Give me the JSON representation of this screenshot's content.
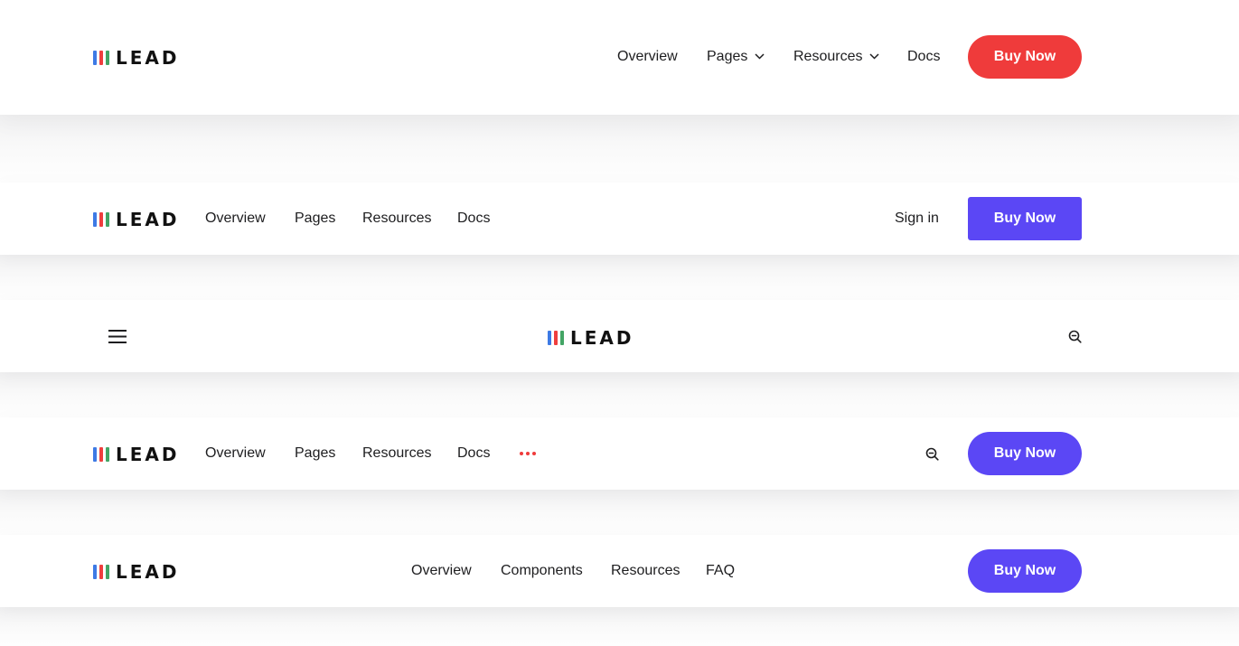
{
  "brand": {
    "name": "LEAD"
  },
  "colors": {
    "accent_red": "#ef3b3b",
    "accent_purple": "#5b47f5",
    "logo_bar_blue": "#3d7ae5",
    "logo_bar_red": "#ef3e3e",
    "logo_bar_green": "#43a565"
  },
  "navbar1": {
    "links": [
      "Overview",
      "Pages",
      "Resources",
      "Docs"
    ],
    "dropdown_icon": "chevron-down-icon",
    "cta": "Buy Now"
  },
  "navbar2": {
    "links": [
      "Overview",
      "Pages",
      "Resources",
      "Docs"
    ],
    "signin": "Sign in",
    "cta": "Buy Now"
  },
  "navbar3": {
    "menu_icon": "hamburger-menu-icon",
    "search_icon": "search-icon"
  },
  "navbar4": {
    "links": [
      "Overview",
      "Pages",
      "Resources",
      "Docs"
    ],
    "more_icon": "more-dots-icon",
    "search_icon": "search-icon",
    "cta": "Buy Now"
  },
  "navbar5": {
    "links": [
      "Overview",
      "Components",
      "Resources",
      "FAQ"
    ],
    "cta": "Buy Now"
  }
}
